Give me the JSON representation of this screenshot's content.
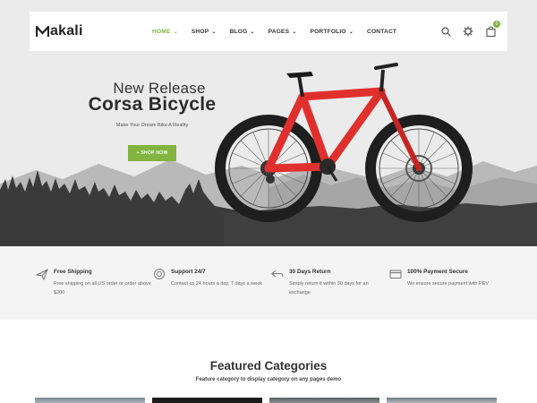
{
  "brand": {
    "name": "akali",
    "logo_letter": "M"
  },
  "nav": {
    "items": [
      {
        "label": "HOME",
        "dropdown": true,
        "active": true
      },
      {
        "label": "SHOP",
        "dropdown": true
      },
      {
        "label": "BLOG",
        "dropdown": true
      },
      {
        "label": "PAGES",
        "dropdown": true
      },
      {
        "label": "PORTFOLIO",
        "dropdown": true
      },
      {
        "label": "CONTACT",
        "dropdown": false
      }
    ],
    "chevron": "⌄"
  },
  "header_icons": [
    "search-icon",
    "settings-icon",
    "cart-icon"
  ],
  "cart_count": "0",
  "hero": {
    "subtitle": "New Release",
    "title": "Corsa Bicycle",
    "tagline": "Make Your Dream Bike A Reality",
    "button_label": "+ SHOP NOW"
  },
  "features": [
    {
      "icon": "plane-icon",
      "title": "Free Shipping",
      "desc": "Free shipping on all US order or order above $200"
    },
    {
      "icon": "support-icon",
      "title": "Support 24/7",
      "desc": "Contact us 24 hours a day, 7 days a week"
    },
    {
      "icon": "return-icon",
      "title": "30 Days Return",
      "desc": "Simply return it within 30 days for an exchange"
    },
    {
      "icon": "card-icon",
      "title": "100% Payment Secure",
      "desc": "We ensure secure payment with PEV"
    }
  ],
  "categories": {
    "title": "Featured Categories",
    "subtitle": "Feature category to display category on any pages demo"
  },
  "colors": {
    "accent": "#82b440",
    "hero_bg": "#ebebeb",
    "forest": "#3a3a3a",
    "bike_red": "#e0302e"
  }
}
